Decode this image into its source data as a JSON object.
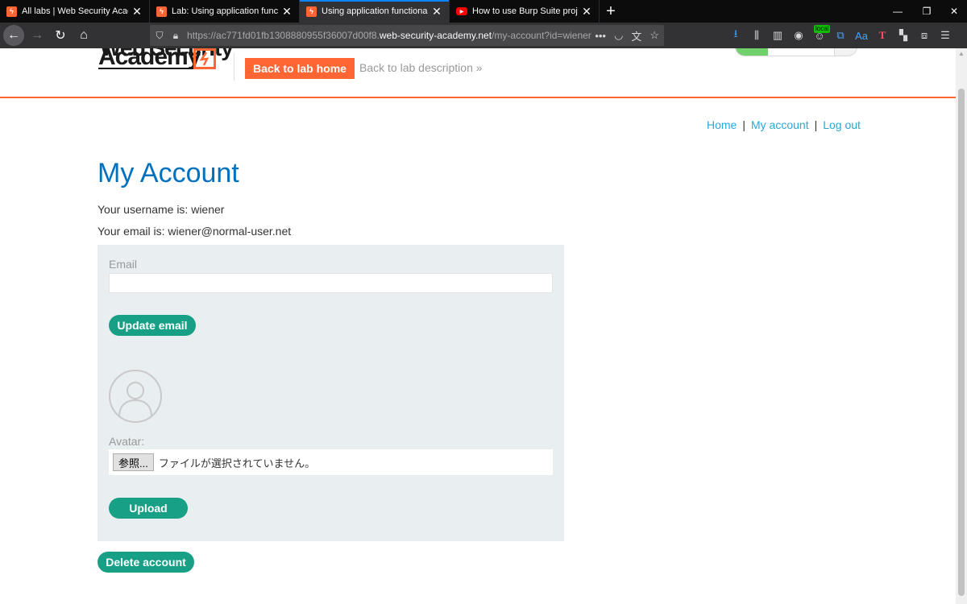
{
  "browser": {
    "tabs": [
      {
        "title": "All labs | Web Security Academy",
        "favicon": "web-security-academy-icon"
      },
      {
        "title": "Lab: Using application functionality",
        "favicon": "web-security-academy-icon"
      },
      {
        "title": "Using application functionality",
        "favicon": "web-security-academy-icon",
        "active": true
      },
      {
        "title": "How to use Burp Suite projects",
        "favicon": "youtube-icon"
      }
    ],
    "url": {
      "prefix": "https://ac771fd01fb1308880955f36007d00f8.",
      "domain": "web-security-academy.net",
      "path": "/my-account?id=wiener"
    },
    "local_badge": "local"
  },
  "header": {
    "logo_top": "Web Security",
    "logo_bottom": "Academy",
    "back_to_lab": "Back to lab home",
    "back_to_description": "Back to lab description »"
  },
  "nav": {
    "home": "Home",
    "separator": "|",
    "my_account": "My account",
    "log_out": "Log out"
  },
  "account": {
    "title": "My Account",
    "username_line": "Your username is: wiener",
    "email_line": "Your email is: wiener@normal-user.net"
  },
  "form": {
    "email_label": "Email",
    "email_value": "",
    "update_email": "Update email",
    "avatar_label": "Avatar:",
    "file_button": "参照...",
    "file_status": "ファイルが選択されていません。",
    "upload": "Upload"
  },
  "delete_account": "Delete account",
  "colors": {
    "accent_orange": "#ff6633",
    "title_blue": "#0071bc",
    "link_blue": "#29a8d8",
    "button_green": "#18a087",
    "form_bg": "#e9eef1"
  }
}
